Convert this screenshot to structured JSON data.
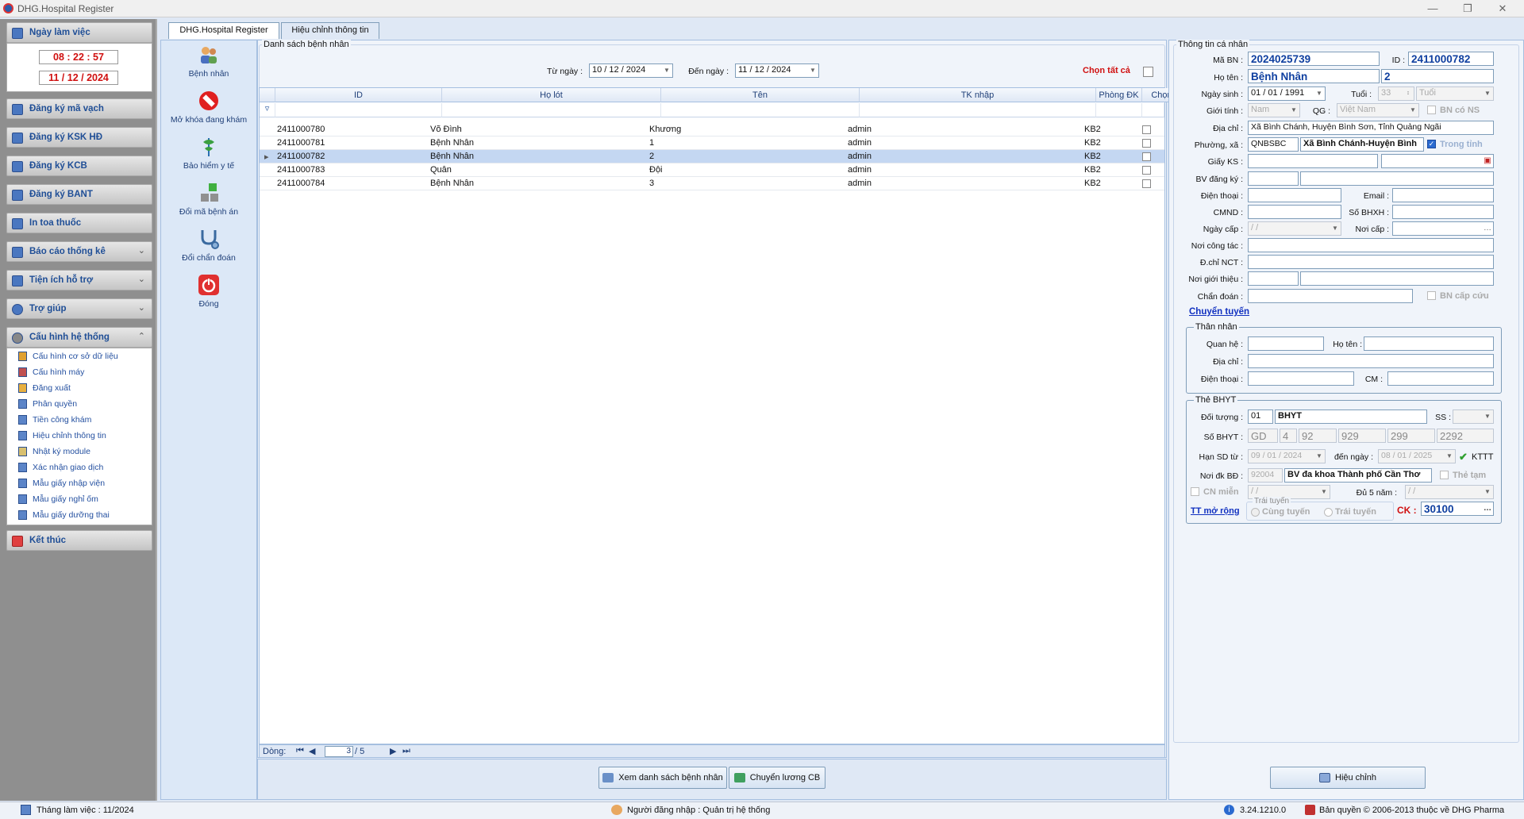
{
  "window": {
    "title": "DHG.Hospital Register"
  },
  "sidebar": {
    "workday_label": "Ngày làm việc",
    "time": "08 : 22 : 57",
    "date": "11 / 12 / 2024",
    "groups": [
      {
        "label": "Đăng ký mã vạch"
      },
      {
        "label": "Đăng ký KSK HĐ"
      },
      {
        "label": "Đăng ký KCB"
      },
      {
        "label": "Đăng ký BANT"
      },
      {
        "label": "In toa thuốc"
      },
      {
        "label": "Báo cáo thống kê"
      },
      {
        "label": "Tiện ích hỗ trợ"
      },
      {
        "label": "Trợ giúp"
      },
      {
        "label": "Cấu hình hệ thống"
      }
    ],
    "config_items": [
      "Cấu hình cơ sở dữ liệu",
      "Cấu hình máy",
      "Đăng xuất",
      "Phân quyền",
      "Tiền công khám",
      "Hiệu chỉnh thông tin",
      "Nhật ký module",
      "Xác nhận giao dịch",
      "Mẫu giấy nhập viện",
      "Mẫu giấy nghỉ ốm",
      "Mẫu giấy dưỡng thai"
    ],
    "exit": "Kết thúc"
  },
  "tabs": [
    "DHG.Hospital Register",
    "Hiệu chỉnh thông tin"
  ],
  "tools": [
    "Bệnh nhân",
    "Mở khóa đang khám",
    "Bảo hiểm y tế",
    "Đổi mã bệnh án",
    "Đổi chẩn đoán",
    "Đóng"
  ],
  "list": {
    "group_title": "Danh sách bệnh nhân",
    "from_label": "Từ ngày :",
    "from_value": "10 / 12 / 2024",
    "to_label": "Đến  ngày :",
    "to_value": "11 / 12 / 2024",
    "select_all": "Chọn tất cả",
    "columns": [
      "ID",
      "Họ lót",
      "Tên",
      "TK nhập",
      "Phòng ĐK",
      "Chọn"
    ],
    "rows": [
      [
        "2411000780",
        "Võ Đình",
        "Khương",
        "admin",
        "KB2"
      ],
      [
        "2411000781",
        "Bệnh Nhân",
        "1",
        "admin",
        "KB2"
      ],
      [
        "2411000782",
        "Bệnh Nhân",
        "2",
        "admin",
        "KB2"
      ],
      [
        "2411000783",
        "Quân",
        "Đội",
        "admin",
        "KB2"
      ],
      [
        "2411000784",
        "Bệnh Nhân",
        "3",
        "admin",
        "KB2"
      ]
    ],
    "nav_label": "Dòng:",
    "nav_current": "3",
    "nav_total": "/   5"
  },
  "buttons": {
    "view_list": "Xem danh sách bệnh nhân",
    "transfer": "Chuyển lương CB",
    "edit": "Hiệu chỉnh"
  },
  "patient": {
    "group_title": "Thông tin cá nhân",
    "ma_bn_label": "Mã BN :",
    "ma_bn": "2024025739",
    "id_label": "ID :",
    "id": "2411000782",
    "ho_ten_label": "Họ tên :",
    "ho_lot": "Bệnh Nhân",
    "ten": "2",
    "ngay_sinh_label": "Ngày sinh :",
    "ngay_sinh": "01 / 01 / 1991",
    "tuoi_label": "Tuổi :",
    "tuoi": "33",
    "tuoi_unit": "Tuổi",
    "gioi_tinh_label": "Giới tính :",
    "gioi_tinh": "Nam",
    "qg_label": "QG :",
    "qg": "Việt Nam",
    "bn_co_ns": "BN có NS",
    "dia_chi_label": "Địa chỉ :",
    "dia_chi": "Xã Bình Chánh, Huyện Bình Sơn, Tỉnh Quảng Ngãi",
    "phuong_xa_label": "Phường, xã :",
    "phuong_xa_code": "QNBSBC",
    "phuong_xa": "Xã Bình Chánh-Huyện Bình",
    "trong_tinh": "Trong tỉnh",
    "giay_ks_label": "Giấy KS :",
    "bv_dang_ky_label": "BV đăng ký :",
    "dien_thoai_label": "Điện thoại :",
    "email_label": "Email :",
    "cmnd_label": "CMND :",
    "so_bhxh_label": "Số BHXH :",
    "ngay_cap_label": "Ngày cấp :",
    "ngay_cap": "  /    /",
    "noi_cap_label": "Nơi cấp :",
    "noi_cong_tac_label": "Nơi công tác :",
    "dchi_nct_label": "Đ.chỉ NCT :",
    "noi_gioi_thieu_label": "Nơi giới thiệu :",
    "chan_doan_label": "Chẩn đoán :",
    "bn_cap_cuu": "BN cấp cứu",
    "chuyen_tuyen": "Chuyển tuyến"
  },
  "relative": {
    "group_title": "Thân nhân",
    "quan_he_label": "Quan hệ :",
    "ho_ten_label": "Họ tên :",
    "dia_chi_label": "Địa chỉ :",
    "dien_thoai_label": "Điện thoại :",
    "cm_label": "CM :"
  },
  "insurance": {
    "group_title": "Thẻ BHYT",
    "doi_tuong_label": "Đối tượng :",
    "doi_tuong_code": "01",
    "doi_tuong": "BHYT",
    "ss_label": "SS :",
    "so_bhyt_label": "Số BHYT :",
    "so_bhyt_parts": [
      "GD",
      "4",
      "92",
      "929",
      "299",
      "2292"
    ],
    "han_sd_label": "Hạn SD từ :",
    "han_sd_from": "09 / 01 / 2024",
    "den_ngay_label": "đến  ngày :",
    "han_sd_to": "08 / 01 / 2025",
    "kttt": "KTTT",
    "noi_dk_label": "Nơi đk BĐ :",
    "noi_dk_code": "92004",
    "noi_dk": "BV đa khoa Thành phố Cần Thơ",
    "the_tam": "Thẻ tạm",
    "cn_mien": "CN miễn",
    "cn_mien_date": "  /    /",
    "du5nam_label": "Đủ 5 năm :",
    "du5nam": "  /    /",
    "tt_mo_rong": "TT mở rộng",
    "trai_tuyen_group": "Trái tuyến",
    "cung_tuyen": "Cùng tuyến",
    "trai_tuyen": "Trái tuyến",
    "ck_label": "CK :",
    "ck": "30100"
  },
  "status": {
    "month": "Tháng làm việc : 11/2024",
    "user": "Người đăng nhập : Quản trị hệ thống",
    "version": "3.24.1210.0",
    "copyright": "Bản quyền © 2006-2013 thuộc về DHG Pharma"
  }
}
